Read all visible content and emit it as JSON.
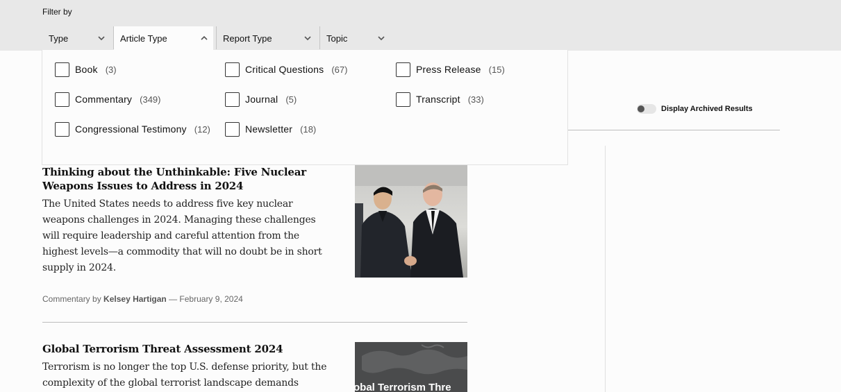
{
  "filter": {
    "label": "Filter by",
    "dropdowns": [
      {
        "label": "Type",
        "open": false
      },
      {
        "label": "Article Type",
        "open": true
      },
      {
        "label": "Report Type",
        "open": false
      },
      {
        "label": "Topic",
        "open": false
      }
    ]
  },
  "article_type_options": [
    {
      "label": "Book",
      "count": "(3)"
    },
    {
      "label": "Commentary",
      "count": "(349)"
    },
    {
      "label": "Congressional Testimony",
      "count": "(12)"
    },
    {
      "label": "Critical Questions",
      "count": "(67)"
    },
    {
      "label": "Journal",
      "count": "(5)"
    },
    {
      "label": "Newsletter",
      "count": "(18)"
    },
    {
      "label": "Press Release",
      "count": "(15)"
    },
    {
      "label": "Transcript",
      "count": "(33)"
    }
  ],
  "archive": {
    "label": "Display Archived Results",
    "enabled": false
  },
  "articles": [
    {
      "title": "Thinking about the Unthinkable: Five Nuclear Weapons Issues to Address in 2024",
      "description": "The United States needs to address five key nuclear weapons challenges in 2024. Managing these challenges will require leadership and careful attention from the highest levels—a commodity that will no doubt be in short supply in 2024.",
      "meta_prefix": "Commentary by",
      "author": "Kelsey Hartigan",
      "meta_suffix": " — February 9, 2024",
      "image_icon": "photo-two-leaders-handshake"
    },
    {
      "title": "Global Terrorism Threat Assessment 2024",
      "description": "Terrorism is no longer the top U.S. defense priority, but the complexity of the global terrorist landscape demands",
      "image_icon": "report-cover-map",
      "image_text": "obal Terrorism Thre"
    }
  ],
  "colors": {
    "filter_bg": "#e8e8e8",
    "text": "#111111",
    "meta": "#666666",
    "divider": "#bdbdbd"
  }
}
